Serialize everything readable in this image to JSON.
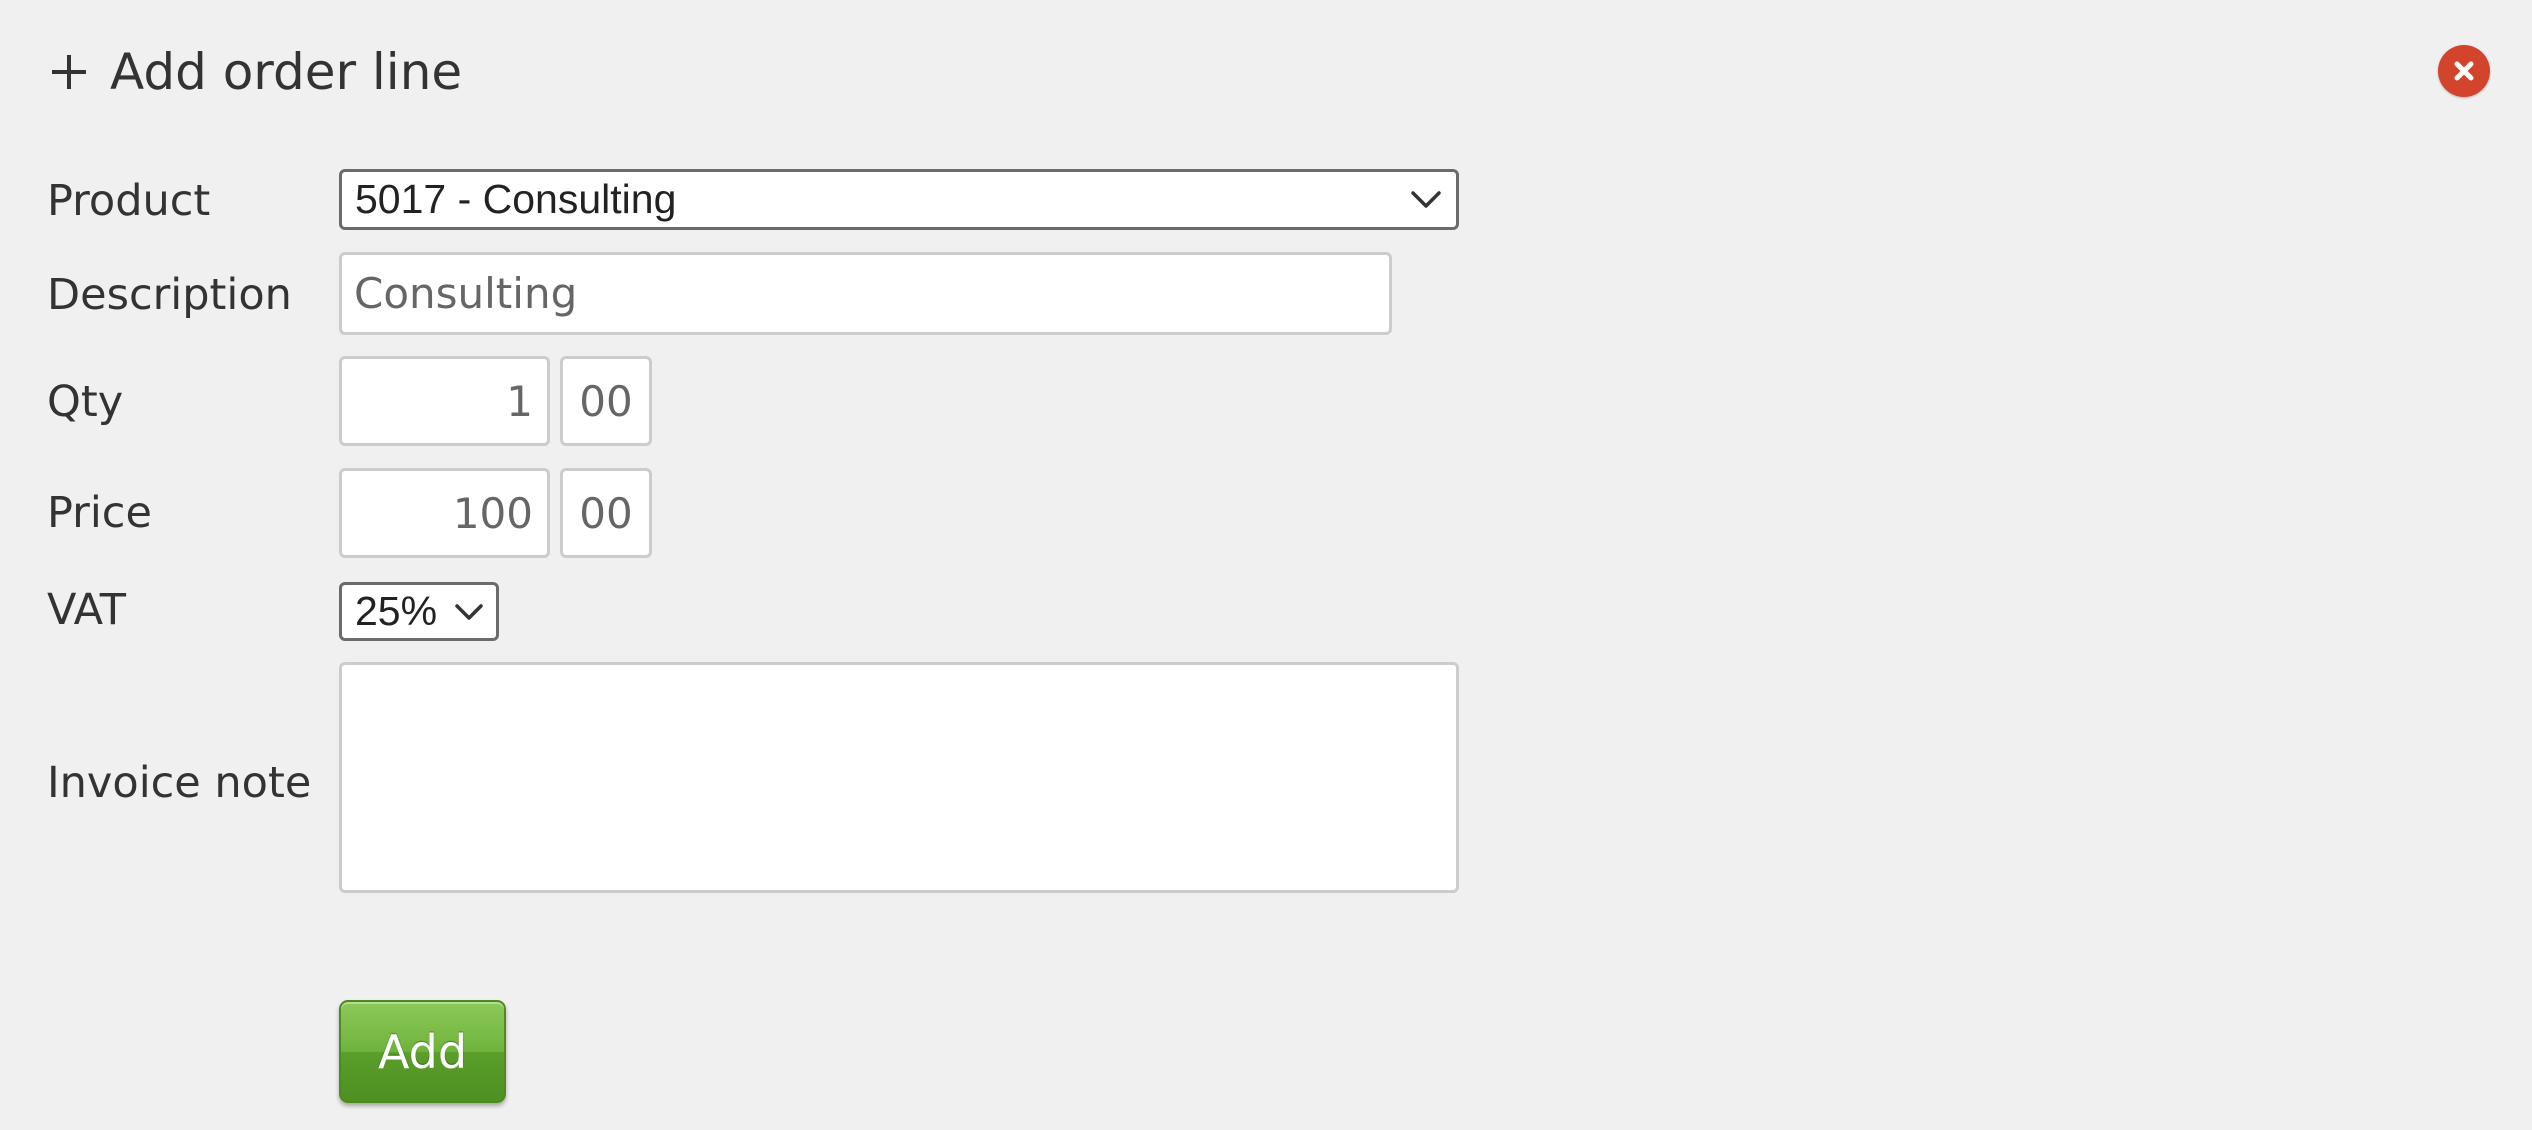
{
  "dialog": {
    "title": "Add order line",
    "close_label": "×"
  },
  "form": {
    "product": {
      "label": "Product",
      "value": "5017 - Consulting"
    },
    "description": {
      "label": "Description",
      "placeholder": "Consulting",
      "value": ""
    },
    "qty": {
      "label": "Qty",
      "whole": "1",
      "decimals": "00"
    },
    "price": {
      "label": "Price",
      "whole": "100",
      "decimals": "00"
    },
    "vat": {
      "label": "VAT",
      "value": "25%"
    },
    "invoice_note": {
      "label": "Invoice note",
      "value": ""
    },
    "submit_label": "Add"
  },
  "colors": {
    "close_button": "#d2452c",
    "add_button": "#6fb33b",
    "background": "#f0f0f0"
  }
}
